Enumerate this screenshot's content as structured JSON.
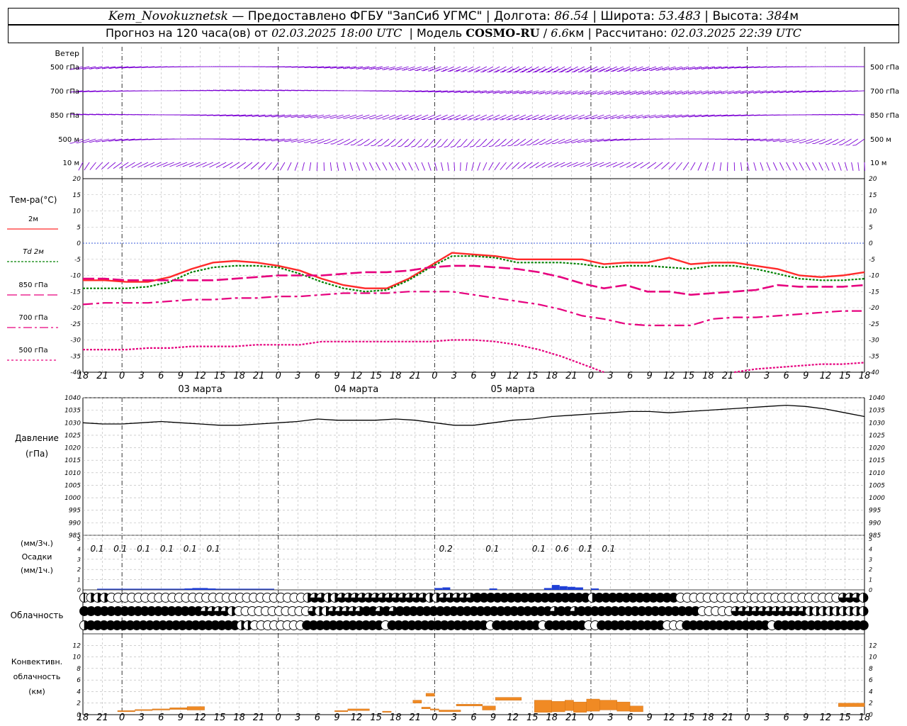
{
  "header": {
    "station": "Kem_Novokuznetsk",
    "sep1": " — ",
    "provider": "Предоставлено ФГБУ \"ЗапСиб УГМС\"",
    "lon_label": "Долгота:",
    "lon": "86.54",
    "lat_label": "Широта:",
    "lat": "53.483",
    "alt_label": "Высота:",
    "alt": "384",
    "alt_unit": "м",
    "forecast_label": "Прогноз на 120 часа(ов) от",
    "forecast_from": "02.03.2025 18:00 UTC",
    "model_label": "Модель",
    "model": "COSMO-RU",
    "resolution": "6.6",
    "resolution_unit": "км",
    "calc_label": "Рассчитано:",
    "calc_time": "02.03.2025 22:39 UTC"
  },
  "wind_panel": {
    "title": "Ветер",
    "levels": [
      "500 гПа",
      "700 гПа",
      "850 гПа",
      "500 м",
      "10 м"
    ]
  },
  "temp_panel": {
    "title": "Тем-ра(°C)",
    "legend": [
      {
        "label": "2м",
        "color": "#ff2a2a"
      },
      {
        "label": "Td 2м",
        "color": "#008000"
      },
      {
        "label": "850 гПа",
        "color": "#e6007e"
      },
      {
        "label": "700 гПа",
        "color": "#e6007e"
      },
      {
        "label": "500 гПа",
        "color": "#e6007e"
      }
    ]
  },
  "pressure_panel": {
    "title": "Давление",
    "unit": "(гПа)"
  },
  "precip_panel": {
    "unit_3h": "(мм/3ч.)",
    "title": "Осадки",
    "unit_1h": "(мм/1ч.)"
  },
  "cloud_panel": {
    "title": "Облачность"
  },
  "conv_panel": {
    "title1": "Конвективн.",
    "title2": "облачность",
    "unit": "(км)"
  },
  "time_axis": {
    "hour_labels": [
      "18",
      "21",
      "0",
      "3",
      "6",
      "9",
      "12",
      "15",
      "18",
      "21",
      "0",
      "3",
      "6",
      "9",
      "12",
      "15",
      "18",
      "21",
      "0",
      "3",
      "6",
      "9",
      "12",
      "15",
      "18",
      "21",
      "0"
    ],
    "date_labels": [
      "03 марта",
      "04 марта",
      "05 марта"
    ]
  },
  "chart_data": [
    {
      "type": "line",
      "name": "temperature",
      "x_hours": [
        0,
        3,
        6,
        9,
        12,
        15,
        18,
        21,
        24,
        27,
        30,
        33,
        36,
        39,
        42,
        45,
        48,
        51,
        54,
        57,
        60,
        63,
        66,
        69,
        72,
        75,
        78,
        81,
        84,
        87,
        90,
        93,
        96,
        99,
        102,
        105,
        108,
        111,
        114,
        117,
        120
      ],
      "ylim": [
        -40,
        20
      ],
      "yticks": [
        20,
        15,
        10,
        5,
        0,
        -5,
        -10,
        -15,
        -20,
        -25,
        -30,
        -35,
        -40
      ],
      "series": [
        {
          "name": "2м",
          "color": "#ff2a2a",
          "style": "solid",
          "values": [
            -11.5,
            -11.5,
            -12,
            -12,
            -10.5,
            -8,
            -6,
            -5.5,
            -6,
            -7,
            -8.5,
            -11,
            -13,
            -14,
            -14,
            -11,
            -7,
            -3,
            -3.5,
            -4,
            -5,
            -5,
            -5,
            -5,
            -6.5,
            -6,
            -6,
            -4.5,
            -6.5,
            -6,
            -6,
            -7,
            -8,
            -10,
            -10.5,
            -10,
            -9
          ]
        },
        {
          "name": "Td 2м",
          "color": "#008000",
          "style": "dotted",
          "values": [
            -14,
            -14,
            -14,
            -13.5,
            -12,
            -9,
            -7.5,
            -7,
            -7,
            -7.5,
            -9.5,
            -12,
            -14,
            -15,
            -14.5,
            -11.5,
            -7.5,
            -4,
            -4,
            -4.5,
            -6,
            -6,
            -6,
            -6.5,
            -7.5,
            -7,
            -7,
            -7.5,
            -8,
            -7,
            -7,
            -8,
            -9.5,
            -11,
            -11.5,
            -11.5,
            -11
          ]
        },
        {
          "name": "850 гПа",
          "color": "#e6007e",
          "style": "longdash",
          "values": [
            -11,
            -11,
            -11.5,
            -11.5,
            -11.5,
            -11.5,
            -11.5,
            -11,
            -10.5,
            -10,
            -10,
            -10,
            -9.5,
            -9,
            -9,
            -8.5,
            -7.5,
            -7,
            -7,
            -7.5,
            -8,
            -9,
            -10.5,
            -12.5,
            -14,
            -13,
            -15,
            -15,
            -16,
            -15.5,
            -15,
            -14.5,
            -13,
            -13.5,
            -13.5,
            -13.5,
            -13
          ]
        },
        {
          "name": "700 гПа",
          "color": "#e6007e",
          "style": "dashdot",
          "values": [
            -19,
            -18.5,
            -18.5,
            -18.5,
            -18,
            -17.5,
            -17.5,
            -17,
            -17,
            -16.5,
            -16.5,
            -16,
            -15.5,
            -15.5,
            -15.5,
            -15,
            -15,
            -15,
            -16,
            -17,
            -18,
            -19,
            -20.5,
            -22.5,
            -23.5,
            -25,
            -25.5,
            -25.5,
            -25.5,
            -23.5,
            -23,
            -23,
            -22.5,
            -22,
            -21.5,
            -21,
            -21
          ]
        },
        {
          "name": "500 гПа",
          "color": "#e6007e",
          "style": "dotted",
          "values": [
            -33,
            -33,
            -33,
            -32.5,
            -32.5,
            -32,
            -32,
            -32,
            -31.5,
            -31.5,
            -31.5,
            -30.5,
            -30.5,
            -30.5,
            -30.5,
            -30.5,
            -30.5,
            -30,
            -30,
            -30.5,
            -31.5,
            -33,
            -35,
            -37.5,
            -40,
            null,
            null,
            null,
            null,
            null,
            -40,
            -39,
            -38.5,
            -38,
            -37.5,
            -37.5,
            -37
          ]
        }
      ]
    },
    {
      "type": "line",
      "name": "pressure",
      "ylim": [
        985,
        1040
      ],
      "yticks": [
        1040,
        1035,
        1030,
        1025,
        1020,
        1015,
        1010,
        1005,
        1000,
        995,
        990,
        985
      ],
      "x_hours": [
        0,
        3,
        6,
        9,
        12,
        15,
        18,
        21,
        24,
        27,
        30,
        33,
        36,
        39,
        42,
        45,
        48,
        51,
        54,
        57,
        60,
        63,
        66,
        69,
        72,
        75,
        78,
        81,
        84,
        87,
        90,
        93,
        96,
        99,
        102,
        105,
        108,
        111,
        114,
        117,
        120
      ],
      "values": [
        1030,
        1029.5,
        1029.5,
        1030,
        1030.5,
        1030,
        1029.5,
        1029,
        1029,
        1029.5,
        1030,
        1030.5,
        1031.5,
        1031,
        1031,
        1031,
        1031.5,
        1031,
        1030,
        1029,
        1029,
        1030,
        1031,
        1031.5,
        1032.5,
        1033,
        1033.5,
        1034,
        1034.5,
        1034.5,
        1034,
        1034.5,
        1035,
        1035.5,
        1036,
        1036.5,
        1037,
        1036.5,
        1035.5,
        1034,
        1032.5
      ]
    },
    {
      "type": "bar",
      "name": "precipitation",
      "ylim": [
        0,
        5
      ],
      "yticks": [
        5,
        4,
        3,
        2,
        1,
        0
      ],
      "labels_3h": [
        {
          "hour": 1,
          "text": "0.1"
        },
        {
          "hour": 4,
          "text": "0.1"
        },
        {
          "hour": 7,
          "text": "0.1"
        },
        {
          "hour": 10,
          "text": "0.1"
        },
        {
          "hour": 13,
          "text": "0.1"
        },
        {
          "hour": 16,
          "text": "0.1"
        },
        {
          "hour": 46,
          "text": "0.2"
        },
        {
          "hour": 52,
          "text": "0.1"
        },
        {
          "hour": 58,
          "text": "0.1"
        },
        {
          "hour": 61,
          "text": "0.6"
        },
        {
          "hour": 64,
          "text": "0.1"
        },
        {
          "hour": 67,
          "text": "0.1"
        }
      ],
      "bars_1h": [
        {
          "hour": 13,
          "value": 0.1
        },
        {
          "hour": 14,
          "value": 0.15
        },
        {
          "hour": 15,
          "value": 0.15
        },
        {
          "hour": 16,
          "value": 0.1
        },
        {
          "hour": 45,
          "value": 0.15
        },
        {
          "hour": 46,
          "value": 0.2
        },
        {
          "hour": 52,
          "value": 0.1
        },
        {
          "hour": 59,
          "value": 0.15
        },
        {
          "hour": 60,
          "value": 0.4
        },
        {
          "hour": 61,
          "value": 0.3
        },
        {
          "hour": 62,
          "value": 0.25
        },
        {
          "hour": 63,
          "value": 0.2
        },
        {
          "hour": 65,
          "value": 0.1
        }
      ]
    },
    {
      "type": "table",
      "name": "cloudiness",
      "rows": [
        "upper",
        "middle",
        "lower"
      ],
      "symbols": [
        "dhhheeeeeeeeeeeeeeeeeeeeeeeeeeeeehqqhhqqqqqqqqqqqqqhhqqqqqfffffffffffffffffhffffffffffffeeeeeeeeeeeeeeeeeeeeeeeeqqqh",
        "ffffffffffffffffffqqqqheeeeeeeeeeeqhhqqqqqffqfqfffffffffffffffffffffffqffqffffffffffffffffffeeeeeqqqqqqqqqqqhhhhhhhhh",
        "hfffffffffffffffffffffffhheeeeeeeeffffffffffffefffffffffffffffefffffffeffffffeeffffffffffeeefffffffffffffeffffffffffffff"
      ]
    },
    {
      "type": "bar",
      "name": "convective_clouds",
      "ylim": [
        0,
        14
      ],
      "yticks": [
        12,
        10,
        8,
        6,
        4,
        2,
        0
      ],
      "segments": [
        {
          "from": 8,
          "to": 12,
          "base": 0.5,
          "top": 0.7
        },
        {
          "from": 12,
          "to": 16,
          "base": 0.7,
          "top": 0.9
        },
        {
          "from": 16,
          "to": 20,
          "base": 0.8,
          "top": 1.0
        },
        {
          "from": 20,
          "to": 24,
          "base": 0.9,
          "top": 1.2
        },
        {
          "from": 24,
          "to": 28,
          "base": 0.8,
          "top": 1.4
        },
        {
          "from": 58,
          "to": 61,
          "base": 0.5,
          "top": 0.7
        },
        {
          "from": 61,
          "to": 66,
          "base": 0.7,
          "top": 1.0
        },
        {
          "from": 69,
          "to": 71,
          "base": 0.4,
          "top": 0.6
        },
        {
          "from": 76,
          "to": 78,
          "base": 2.0,
          "top": 2.5
        },
        {
          "from": 79,
          "to": 81,
          "base": 3.2,
          "top": 3.7
        },
        {
          "from": 78,
          "to": 80,
          "base": 1.0,
          "top": 1.3
        },
        {
          "from": 80,
          "to": 82,
          "base": 0.8,
          "top": 1.0
        },
        {
          "from": 82,
          "to": 87,
          "base": 0.5,
          "top": 0.8
        },
        {
          "from": 86,
          "to": 92,
          "base": 1.5,
          "top": 1.8
        },
        {
          "from": 92,
          "to": 95,
          "base": 0.8,
          "top": 1.5
        },
        {
          "from": 95,
          "to": 101,
          "base": 2.5,
          "top": 3.0
        },
        {
          "from": 104,
          "to": 108,
          "base": 0.4,
          "top": 2.5
        },
        {
          "from": 108,
          "to": 111,
          "base": 0.5,
          "top": 2.3
        },
        {
          "from": 111,
          "to": 113,
          "base": 0.7,
          "top": 2.5
        },
        {
          "from": 113,
          "to": 116,
          "base": 0.4,
          "top": 2.2
        },
        {
          "from": 116,
          "to": 119,
          "base": 0.6,
          "top": 2.7
        },
        {
          "from": 119,
          "to": 123,
          "base": 0.8,
          "top": 2.5
        },
        {
          "from": 123,
          "to": 126,
          "base": 0.6,
          "top": 2.2
        },
        {
          "from": 126,
          "to": 129,
          "base": 0.5,
          "top": 1.5
        },
        {
          "from": 174,
          "to": 180,
          "base": 1.4,
          "top": 2.0
        }
      ]
    }
  ]
}
